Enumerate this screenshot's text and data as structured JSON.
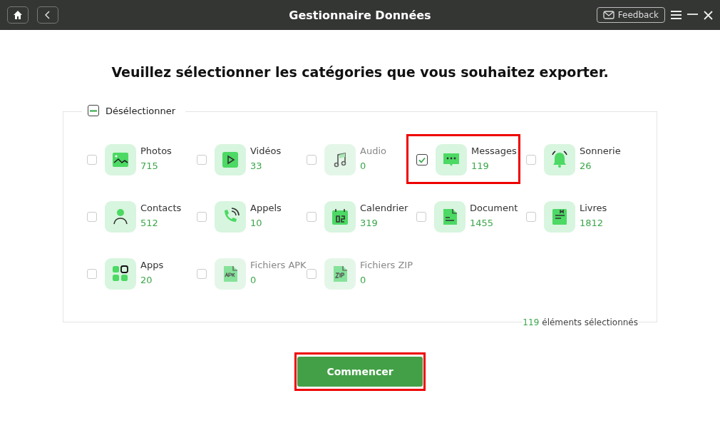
{
  "window": {
    "title": "Gestionnaire Données",
    "feedback": "Feedback"
  },
  "heading": "Veuillez sélectionner les catégories que vous souhaitez exporter.",
  "deselect": {
    "label": "Désélectionner",
    "checked": true
  },
  "categories": [
    {
      "name": "Photos",
      "count": "715",
      "checked": false,
      "disabled": false,
      "highlighted": false
    },
    {
      "name": "Vidéos",
      "count": "33",
      "checked": false,
      "disabled": false,
      "highlighted": false
    },
    {
      "name": "Audio",
      "count": "0",
      "checked": false,
      "disabled": true,
      "highlighted": false
    },
    {
      "name": "Messages",
      "count": "119",
      "checked": true,
      "disabled": false,
      "highlighted": true
    },
    {
      "name": "Sonnerie",
      "count": "26",
      "checked": false,
      "disabled": false,
      "highlighted": false
    },
    {
      "name": "Contacts",
      "count": "512",
      "checked": false,
      "disabled": false,
      "highlighted": false
    },
    {
      "name": "Appels",
      "count": "10",
      "checked": false,
      "disabled": false,
      "highlighted": false
    },
    {
      "name": "Calendrier",
      "count": "319",
      "checked": false,
      "disabled": false,
      "highlighted": false
    },
    {
      "name": "Document",
      "count": "1455",
      "checked": false,
      "disabled": false,
      "highlighted": false
    },
    {
      "name": "Livres",
      "count": "1812",
      "checked": false,
      "disabled": false,
      "highlighted": false
    },
    {
      "name": "Apps",
      "count": "20",
      "checked": false,
      "disabled": false,
      "highlighted": false
    },
    {
      "name": "Fichiers APK",
      "count": "0",
      "checked": false,
      "disabled": true,
      "highlighted": false
    },
    {
      "name": "Fichiers ZIP",
      "count": "0",
      "checked": false,
      "disabled": true,
      "highlighted": false
    }
  ],
  "selection": {
    "count": "119",
    "label": "éléments sélectionnés"
  },
  "start_button": {
    "label": "Commencer",
    "highlighted": true
  }
}
